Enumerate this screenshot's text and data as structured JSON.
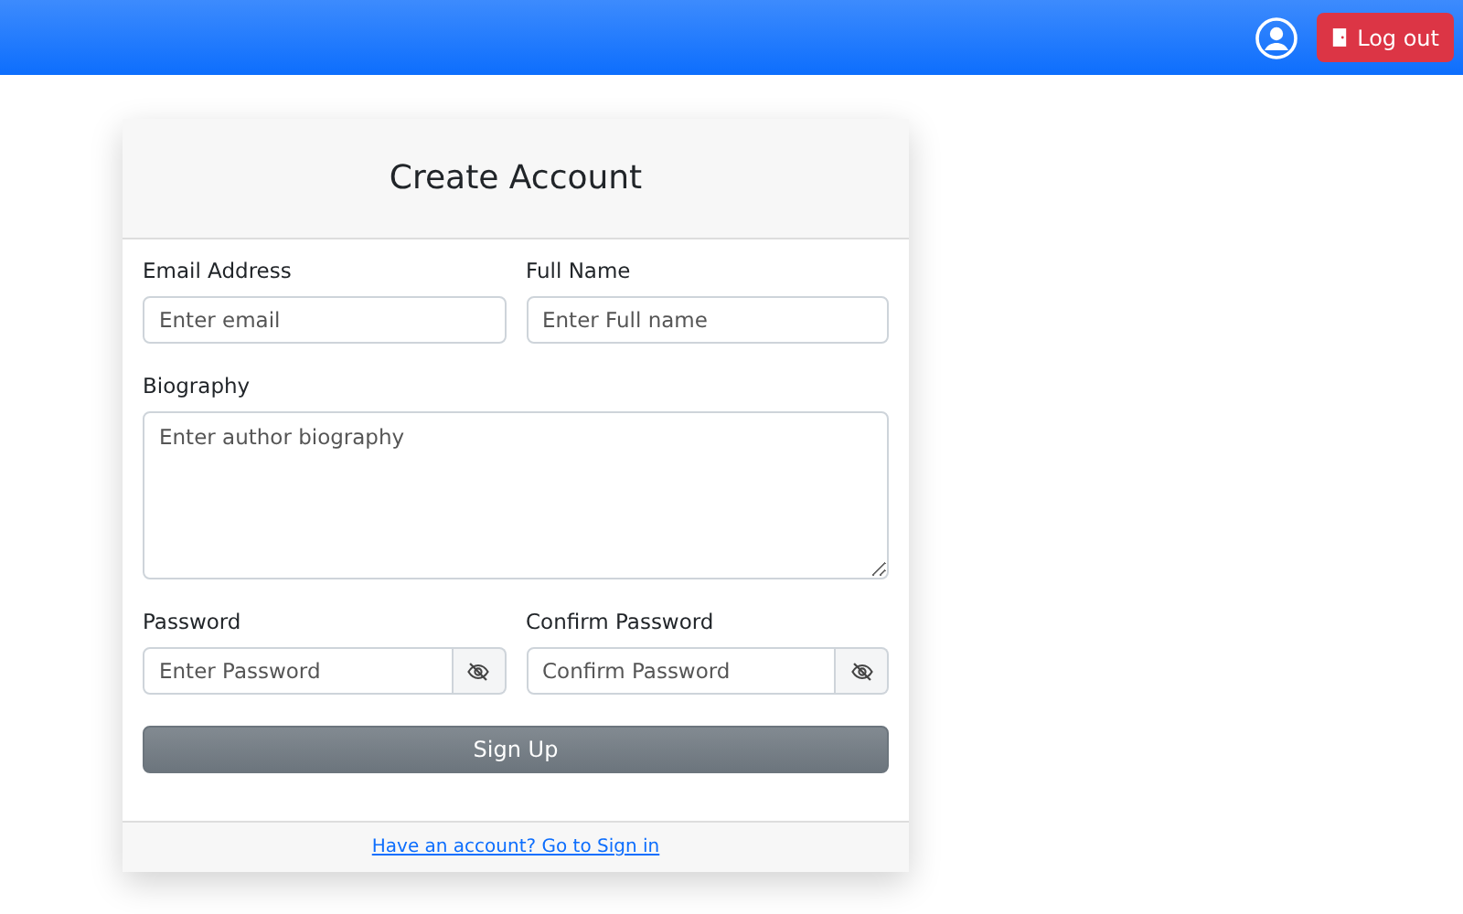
{
  "navbar": {
    "logout_button": "Log out"
  },
  "card": {
    "title": "Create Account",
    "rows": [
      {
        "fields": [
          {
            "label": "Email Address",
            "kind": "text",
            "placeholder": "Enter email"
          },
          {
            "label": "Full Name",
            "kind": "text",
            "placeholder": "Enter Full name"
          }
        ]
      },
      {
        "fields": [
          {
            "label": "Biography",
            "kind": "textarea",
            "placeholder": "Enter author biography"
          }
        ]
      },
      {
        "fields": [
          {
            "label": "Password",
            "kind": "password",
            "placeholder": "Enter Password"
          },
          {
            "label": "Confirm Password",
            "kind": "password",
            "placeholder": "Confirm Password"
          }
        ]
      }
    ],
    "submit_button": "Sign Up",
    "footer_link": "Have an account? Go to Sign in"
  }
}
